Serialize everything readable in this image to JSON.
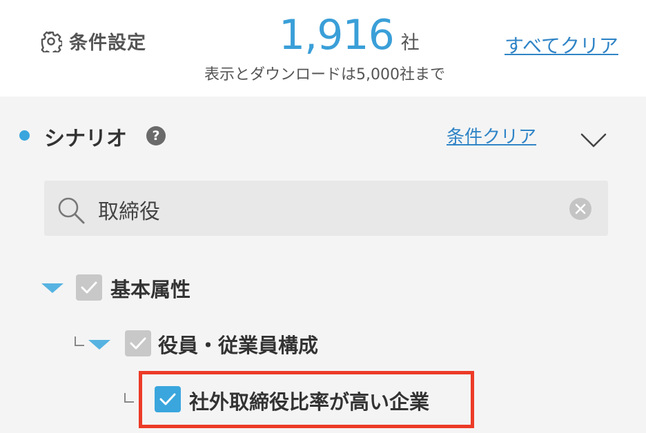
{
  "header": {
    "settings_label": "条件設定",
    "result_count": "1,916",
    "result_unit": "社",
    "limit_note": "表示とダウンロードは5,000社まで",
    "clear_all": "すべてクリア"
  },
  "section": {
    "title": "シナリオ",
    "help": "?",
    "condition_clear": "条件クリア"
  },
  "search": {
    "query": "取締役"
  },
  "tree": {
    "level1": {
      "label": "基本属性",
      "state": "partial"
    },
    "level2": {
      "label": "役員・従業員構成",
      "state": "partial"
    },
    "level3": {
      "label": "社外取締役比率が高い企業",
      "state": "checked"
    }
  },
  "colors": {
    "accent": "#3aa6dd",
    "link": "#2f84c6",
    "count": "#3a9fd8",
    "highlight_border": "#ec3b27",
    "panel_bg": "#f4f4f4"
  }
}
